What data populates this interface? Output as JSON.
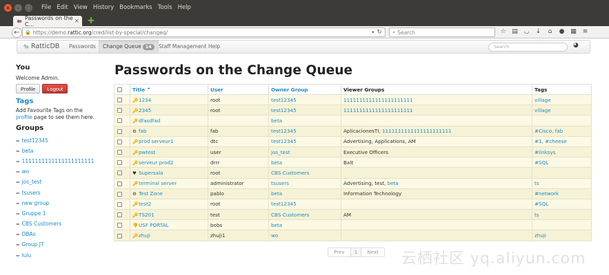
{
  "os": {
    "menu": [
      "File",
      "Edit",
      "View",
      "History",
      "Bookmarks",
      "Tools",
      "Help"
    ]
  },
  "browser": {
    "tab_title": "Passwords on the C...",
    "url_prefix": "https://demo.",
    "url_domain": "rattic.org",
    "url_path": "/cred/list-by-special/changeq/",
    "search_placeholder": "Search"
  },
  "app": {
    "brand": "RatticDB",
    "nav": {
      "passwords": "Passwords",
      "change_queue": "Change Queue",
      "change_queue_count": "14",
      "staff": "Staff Management",
      "help": "Help"
    },
    "search_placeholder": "Search"
  },
  "sidebar": {
    "you_heading": "You",
    "welcome": "Welcome Admin.",
    "profile_label": "Profile",
    "logout_label": "Logout",
    "tags_heading": "Tags",
    "tags_text_pre": "Add Favourite Tags on the ",
    "tags_link": "profile",
    "tags_text_post": " page to see them here.",
    "groups_heading": "Groups",
    "groups": [
      "test12345",
      "beta",
      "1111111111111111111111",
      "wo",
      "jos_test",
      "tsusers",
      "new group",
      "Gruppe 1",
      "CBS Customers",
      "DBAs",
      "Group JT",
      "lulu"
    ]
  },
  "main": {
    "title": "Passwords on the Change Queue",
    "columns": {
      "title": "Title",
      "user": "User",
      "owner": "Owner Group",
      "viewers": "Viewer Groups",
      "tags": "Tags"
    },
    "rows": [
      {
        "icon": "key-icon",
        "title": "1234",
        "user": "root",
        "owner": "test12345",
        "viewers_text": "",
        "viewers_link": "1111111111111111111111",
        "tags": "village"
      },
      {
        "icon": "key-icon",
        "title": "2345",
        "user": "root",
        "owner": "test12345",
        "viewers_text": "",
        "viewers_link": "1111111111111111111111",
        "tags": "village"
      },
      {
        "icon": "key-icon",
        "title": "dfasdfad",
        "user": "",
        "owner": "beta",
        "viewers_text": "",
        "viewers_link": "",
        "tags": ""
      },
      {
        "icon": "gear-icon",
        "title": "fab",
        "user": "fab",
        "owner": "test12345",
        "viewers_text": "AplicacionesTI, ",
        "viewers_link": "1111111111111111111111",
        "tags": "#Cisco, fab"
      },
      {
        "icon": "key-icon",
        "title": "prod serveur1",
        "user": "dtc",
        "owner": "test12345",
        "viewers_text": "Advertising, Applications, AM",
        "viewers_link": "",
        "tags": "#1, #cheese"
      },
      {
        "icon": "key-icon",
        "title": "pwtest",
        "user": "user",
        "owner": "jos_test",
        "viewers_text": "Executive Officers",
        "viewers_link": "",
        "tags": "#linksys"
      },
      {
        "icon": "key-icon",
        "title": "serveur prod2",
        "user": "drrr",
        "owner": "beta",
        "viewers_text": "Balt",
        "viewers_link": "",
        "tags": "#SQL"
      },
      {
        "icon": "heart-icon",
        "title": "Supersala",
        "user": "root",
        "owner": "CBS Customers",
        "viewers_text": "",
        "viewers_link": "",
        "tags": ""
      },
      {
        "icon": "key-icon",
        "title": "terminal server",
        "user": "administrator",
        "owner": "tsusers",
        "viewers_text": "Advertising, test, ",
        "viewers_link": "beta",
        "tags": "ts"
      },
      {
        "icon": "gear-icon",
        "title": "Test Zone",
        "user": "pablo",
        "owner": "beta",
        "viewers_text": "Information Technology",
        "viewers_link": "",
        "tags": "#network"
      },
      {
        "icon": "key-icon",
        "title": "test2",
        "user": "root",
        "owner": "test12345",
        "viewers_text": "",
        "viewers_link": "",
        "tags": "#SQL"
      },
      {
        "icon": "key-icon",
        "title": "TS201",
        "user": "test",
        "owner": "CBS Customers",
        "viewers_text": "AM",
        "viewers_link": "",
        "tags": "ts"
      },
      {
        "icon": "thumbs-down-icon",
        "title": "USF PORTAL",
        "user": "bobs",
        "owner": "beta",
        "viewers_text": "",
        "viewers_link": "",
        "tags": ""
      },
      {
        "icon": "key-icon",
        "title": "zhuji",
        "user": "zhuji1",
        "owner": "wo",
        "viewers_text": "",
        "viewers_link": "",
        "tags": "zhuji"
      }
    ],
    "pager": {
      "prev": "Prev",
      "current": "1",
      "next": "Next"
    }
  },
  "watermark": "云栖社区 yq.aliyun.com"
}
